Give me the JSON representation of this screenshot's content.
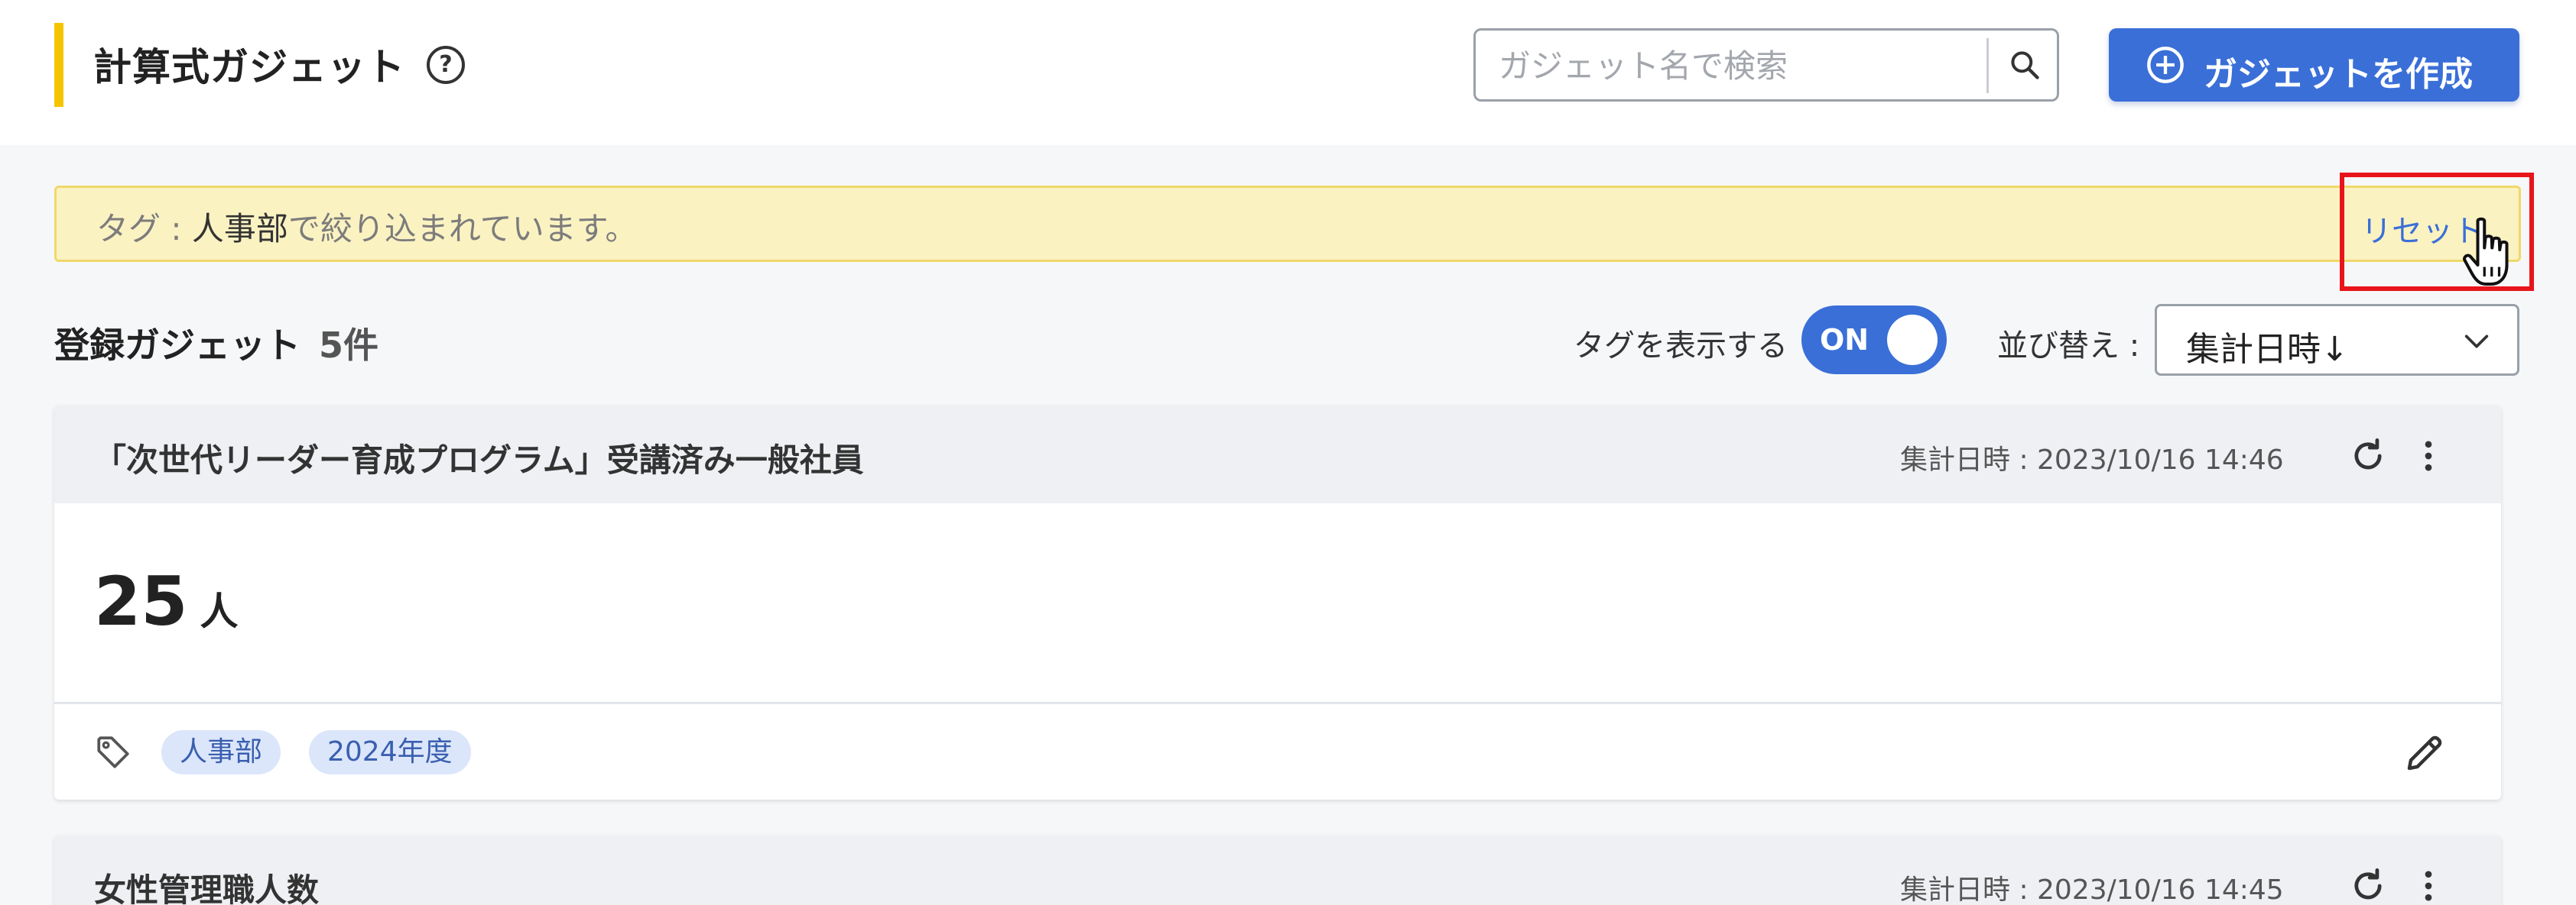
{
  "header": {
    "title": "計算式ガジェット",
    "help_icon": "help-circle-icon",
    "search_placeholder": "ガジェット名で検索",
    "search_value": "",
    "create_label": "ガジェットを作成"
  },
  "filter_banner": {
    "prefix": "タグ : ",
    "tag": "人事部",
    "suffix": "で絞り込まれています。",
    "reset_label": "リセット"
  },
  "toolbar": {
    "registered_label": "登録ガジェット",
    "registered_count": "5件",
    "show_tags_label": "タグを表示する",
    "show_tags_state": "ON",
    "sort_label": "並び替え :",
    "sort_value": "集計日時↓"
  },
  "colors": {
    "accent_yellow": "#f5c400",
    "primary_blue": "#3a6fd8",
    "banner_bg": "#fbf2c2",
    "highlight_red": "#e8141b"
  },
  "gadgets": [
    {
      "title": "「次世代リーダー育成プログラム」受講済み一般社員",
      "date": "集計日時 : 2023/10/16 14:46",
      "value": "25",
      "unit": "人",
      "tags": [
        "人事部",
        "2024年度"
      ]
    },
    {
      "title": "女性管理職人数",
      "date": "集計日時 : 2023/10/16 14:45"
    }
  ]
}
